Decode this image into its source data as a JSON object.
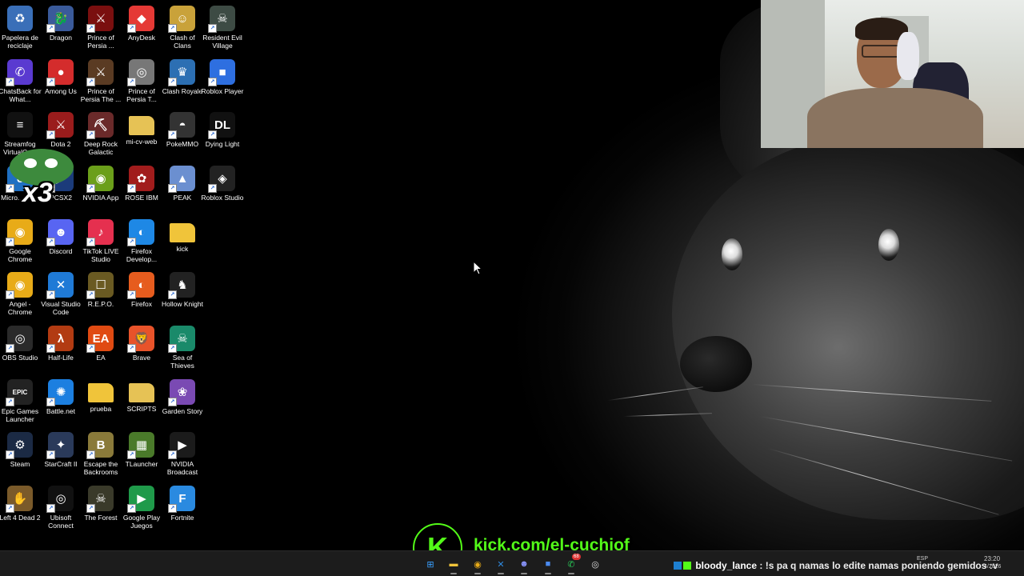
{
  "desktop": {
    "icons": [
      {
        "label": "Papelera de reciclaje",
        "icon": "recycle-bin-icon",
        "color": "#3a6fb8",
        "glyph": "♻",
        "shortcut": false
      },
      {
        "label": "Dragon",
        "icon": "dragon-icon",
        "color": "#3a5a9a",
        "glyph": "🐉",
        "shortcut": true
      },
      {
        "label": "Prince of Persia ...",
        "icon": "prince-of-persia-icon",
        "color": "#7a0f0f",
        "glyph": "⚔",
        "shortcut": true
      },
      {
        "label": "AnyDesk",
        "icon": "anydesk-icon",
        "color": "#e53935",
        "glyph": "◆",
        "shortcut": true
      },
      {
        "label": "Clash of Clans",
        "icon": "clash-of-clans-icon",
        "color": "#c9a23a",
        "glyph": "☺",
        "shortcut": true
      },
      {
        "label": "Resident Evil Village",
        "icon": "resident-evil-icon",
        "color": "#3d4b44",
        "glyph": "☠",
        "shortcut": true
      },
      {
        "label": "ChatsBack for What...",
        "icon": "chatsback-icon",
        "color": "#5a3ad0",
        "glyph": "✆",
        "shortcut": true
      },
      {
        "label": "Among Us",
        "icon": "among-us-icon",
        "color": "#d42c2c",
        "glyph": "●",
        "shortcut": true
      },
      {
        "label": "Prince of Persia The ...",
        "icon": "prince-of-persia-icon",
        "color": "#5a3b23",
        "glyph": "⚔",
        "shortcut": true
      },
      {
        "label": "Prince of Persia T...",
        "icon": "prince-of-persia-icon",
        "color": "#777",
        "glyph": "◎",
        "shortcut": true
      },
      {
        "label": "Clash Royale",
        "icon": "clash-royale-icon",
        "color": "#2c6fb3",
        "glyph": "♛",
        "shortcut": true
      },
      {
        "label": "Roblox Player",
        "icon": "roblox-icon",
        "color": "#2e6fe0",
        "glyph": "■",
        "shortcut": true
      },
      {
        "label": "Streamfog VirtualCam",
        "icon": "streamfog-icon",
        "color": "#111",
        "glyph": "≡",
        "shortcut": false
      },
      {
        "label": "Dota 2",
        "icon": "dota-icon",
        "color": "#9a1c1c",
        "glyph": "⚔",
        "shortcut": true
      },
      {
        "label": "Deep Rock Galactic",
        "icon": "deep-rock-icon",
        "color": "#6a2a2a",
        "glyph": "⛏",
        "shortcut": true
      },
      {
        "label": "mi-cv-web",
        "icon": "folder-icon",
        "color": "#e6c255",
        "glyph": "",
        "shortcut": false
      },
      {
        "label": "PokeMMO",
        "icon": "pokemmo-icon",
        "color": "#333",
        "glyph": "◓",
        "shortcut": true
      },
      {
        "label": "Dying Light",
        "icon": "dying-light-icon",
        "color": "#111",
        "glyph": "DL",
        "shortcut": true
      },
      {
        "label": "Micro... Ed...",
        "icon": "edge-icon",
        "color": "#1f6fc2",
        "glyph": "e",
        "shortcut": true
      },
      {
        "label": "PCSX2",
        "icon": "pcsx2-icon",
        "color": "#1b3b7a",
        "glyph": "▶",
        "shortcut": true
      },
      {
        "label": "NVIDIA App",
        "icon": "nvidia-icon",
        "color": "#6b9f1a",
        "glyph": "◉",
        "shortcut": true
      },
      {
        "label": "ROSE IBM",
        "icon": "rose-icon",
        "color": "#a11c1c",
        "glyph": "✿",
        "shortcut": true
      },
      {
        "label": "PEAK",
        "icon": "peak-icon",
        "color": "#6b8fd0",
        "glyph": "▲",
        "shortcut": true
      },
      {
        "label": "Roblox Studio",
        "icon": "roblox-studio-icon",
        "color": "#222",
        "glyph": "◈",
        "shortcut": true
      },
      {
        "label": "Google Chrome",
        "icon": "chrome-icon",
        "color": "#e8ab18",
        "glyph": "◉",
        "shortcut": true
      },
      {
        "label": "Discord",
        "icon": "discord-icon",
        "color": "#5865f2",
        "glyph": "☻",
        "shortcut": true
      },
      {
        "label": "TikTok LIVE Studio",
        "icon": "tiktok-icon",
        "color": "#e5304f",
        "glyph": "♪",
        "shortcut": true
      },
      {
        "label": "Firefox Develop...",
        "icon": "firefox-dev-icon",
        "color": "#1e88e5",
        "glyph": "◐",
        "shortcut": true
      },
      {
        "label": "kick",
        "icon": "folder-icon",
        "color": "#f0c43a",
        "glyph": "",
        "shortcut": false
      },
      {
        "label": "",
        "icon": "",
        "color": "",
        "glyph": "",
        "shortcut": false
      },
      {
        "label": "Angel - Chrome",
        "icon": "chrome-icon",
        "color": "#e8ab18",
        "glyph": "◉",
        "shortcut": true
      },
      {
        "label": "Visual Studio Code",
        "icon": "vscode-icon",
        "color": "#1f7ad6",
        "glyph": "✕",
        "shortcut": true
      },
      {
        "label": "R.E.P.O.",
        "icon": "repo-icon",
        "color": "#6a5a22",
        "glyph": "☐",
        "shortcut": true
      },
      {
        "label": "Firefox",
        "icon": "firefox-icon",
        "color": "#e65c1e",
        "glyph": "◐",
        "shortcut": true
      },
      {
        "label": "Hollow Knight",
        "icon": "hollow-knight-icon",
        "color": "#222",
        "glyph": "♞",
        "shortcut": true
      },
      {
        "label": "",
        "icon": "",
        "color": "",
        "glyph": "",
        "shortcut": false
      },
      {
        "label": "OBS Studio",
        "icon": "obs-icon",
        "color": "#2a2a2a",
        "glyph": "◎",
        "shortcut": true
      },
      {
        "label": "Half-Life",
        "icon": "half-life-icon",
        "color": "#b23b12",
        "glyph": "λ",
        "shortcut": true
      },
      {
        "label": "EA",
        "icon": "ea-icon",
        "color": "#e04a12",
        "glyph": "EA",
        "shortcut": true
      },
      {
        "label": "Brave",
        "icon": "brave-icon",
        "color": "#e8532a",
        "glyph": "🦁",
        "shortcut": true
      },
      {
        "label": "Sea of Thieves",
        "icon": "sea-of-thieves-icon",
        "color": "#1a8a6a",
        "glyph": "☠",
        "shortcut": true
      },
      {
        "label": "",
        "icon": "",
        "color": "",
        "glyph": "",
        "shortcut": false
      },
      {
        "label": "Epic Games Launcher",
        "icon": "epic-games-icon",
        "color": "#222",
        "glyph": "EPIC",
        "shortcut": true
      },
      {
        "label": "Battle.net",
        "icon": "battlenet-icon",
        "color": "#1c7fe0",
        "glyph": "✺",
        "shortcut": true
      },
      {
        "label": "prueba",
        "icon": "folder-icon",
        "color": "#f0c43a",
        "glyph": "",
        "shortcut": false
      },
      {
        "label": "SCRIPTS",
        "icon": "folder-icon",
        "color": "#e6c255",
        "glyph": "",
        "shortcut": false
      },
      {
        "label": "Garden Story",
        "icon": "garden-story-icon",
        "color": "#7a4ab3",
        "glyph": "❀",
        "shortcut": true
      },
      {
        "label": "",
        "icon": "",
        "color": "",
        "glyph": "",
        "shortcut": false
      },
      {
        "label": "Steam",
        "icon": "steam-icon",
        "color": "#1b2a44",
        "glyph": "⚙",
        "shortcut": true
      },
      {
        "label": "StarCraft II",
        "icon": "starcraft-icon",
        "color": "#2a3a5a",
        "glyph": "✦",
        "shortcut": true
      },
      {
        "label": "Escape the Backrooms",
        "icon": "backrooms-icon",
        "color": "#8a7a3a",
        "glyph": "B",
        "shortcut": true
      },
      {
        "label": "TLauncher",
        "icon": "tlauncher-icon",
        "color": "#4a7a2a",
        "glyph": "▦",
        "shortcut": true
      },
      {
        "label": "NVIDIA Broadcast",
        "icon": "nvidia-broadcast-icon",
        "color": "#1b1b1b",
        "glyph": "▶",
        "shortcut": true
      },
      {
        "label": "",
        "icon": "",
        "color": "",
        "glyph": "",
        "shortcut": false
      },
      {
        "label": "Left 4 Dead 2",
        "icon": "left4dead-icon",
        "color": "#7a5a2a",
        "glyph": "✋",
        "shortcut": true
      },
      {
        "label": "Ubisoft Connect",
        "icon": "ubisoft-icon",
        "color": "#111",
        "glyph": "◎",
        "shortcut": true
      },
      {
        "label": "The Forest",
        "icon": "the-forest-icon",
        "color": "#3a3a2a",
        "glyph": "☠",
        "shortcut": true
      },
      {
        "label": "Google Play Juegos",
        "icon": "google-play-games-icon",
        "color": "#1f9a4a",
        "glyph": "▶",
        "shortcut": true
      },
      {
        "label": "Fortnite",
        "icon": "fortnite-icon",
        "color": "#2a8ae0",
        "glyph": "F",
        "shortcut": true
      },
      {
        "label": "",
        "icon": "",
        "color": "",
        "glyph": "",
        "shortcut": false
      }
    ]
  },
  "overlay": {
    "kick_logo": "K",
    "kick_url": "kick.com/el-cuchiof",
    "sticker_text": "x3"
  },
  "chat": {
    "user": "bloody_lance",
    "separator": " : ",
    "message": "!s pa q namas lo edite namas poniendo gemidos :v"
  },
  "taskbar": {
    "items": [
      {
        "name": "windows-start-icon",
        "glyph": "⊞",
        "color": "#3aa0ff"
      },
      {
        "name": "file-explorer-icon",
        "glyph": "▬",
        "color": "#f0c43a"
      },
      {
        "name": "chrome-icon",
        "glyph": "◉",
        "color": "#e8ab18"
      },
      {
        "name": "vscode-icon",
        "glyph": "✕",
        "color": "#2f8ae0"
      },
      {
        "name": "discord-icon",
        "glyph": "☻",
        "color": "#8a95ff"
      },
      {
        "name": "roblox-icon",
        "glyph": "■",
        "color": "#4a8af0"
      },
      {
        "name": "whatsapp-icon",
        "glyph": "✆",
        "color": "#2ad05a"
      },
      {
        "name": "obs-icon",
        "glyph": "◎",
        "color": "#ddd"
      }
    ],
    "whatsapp_badge": "68",
    "language": "ESP",
    "time": "23:20",
    "date": "4/2026"
  }
}
